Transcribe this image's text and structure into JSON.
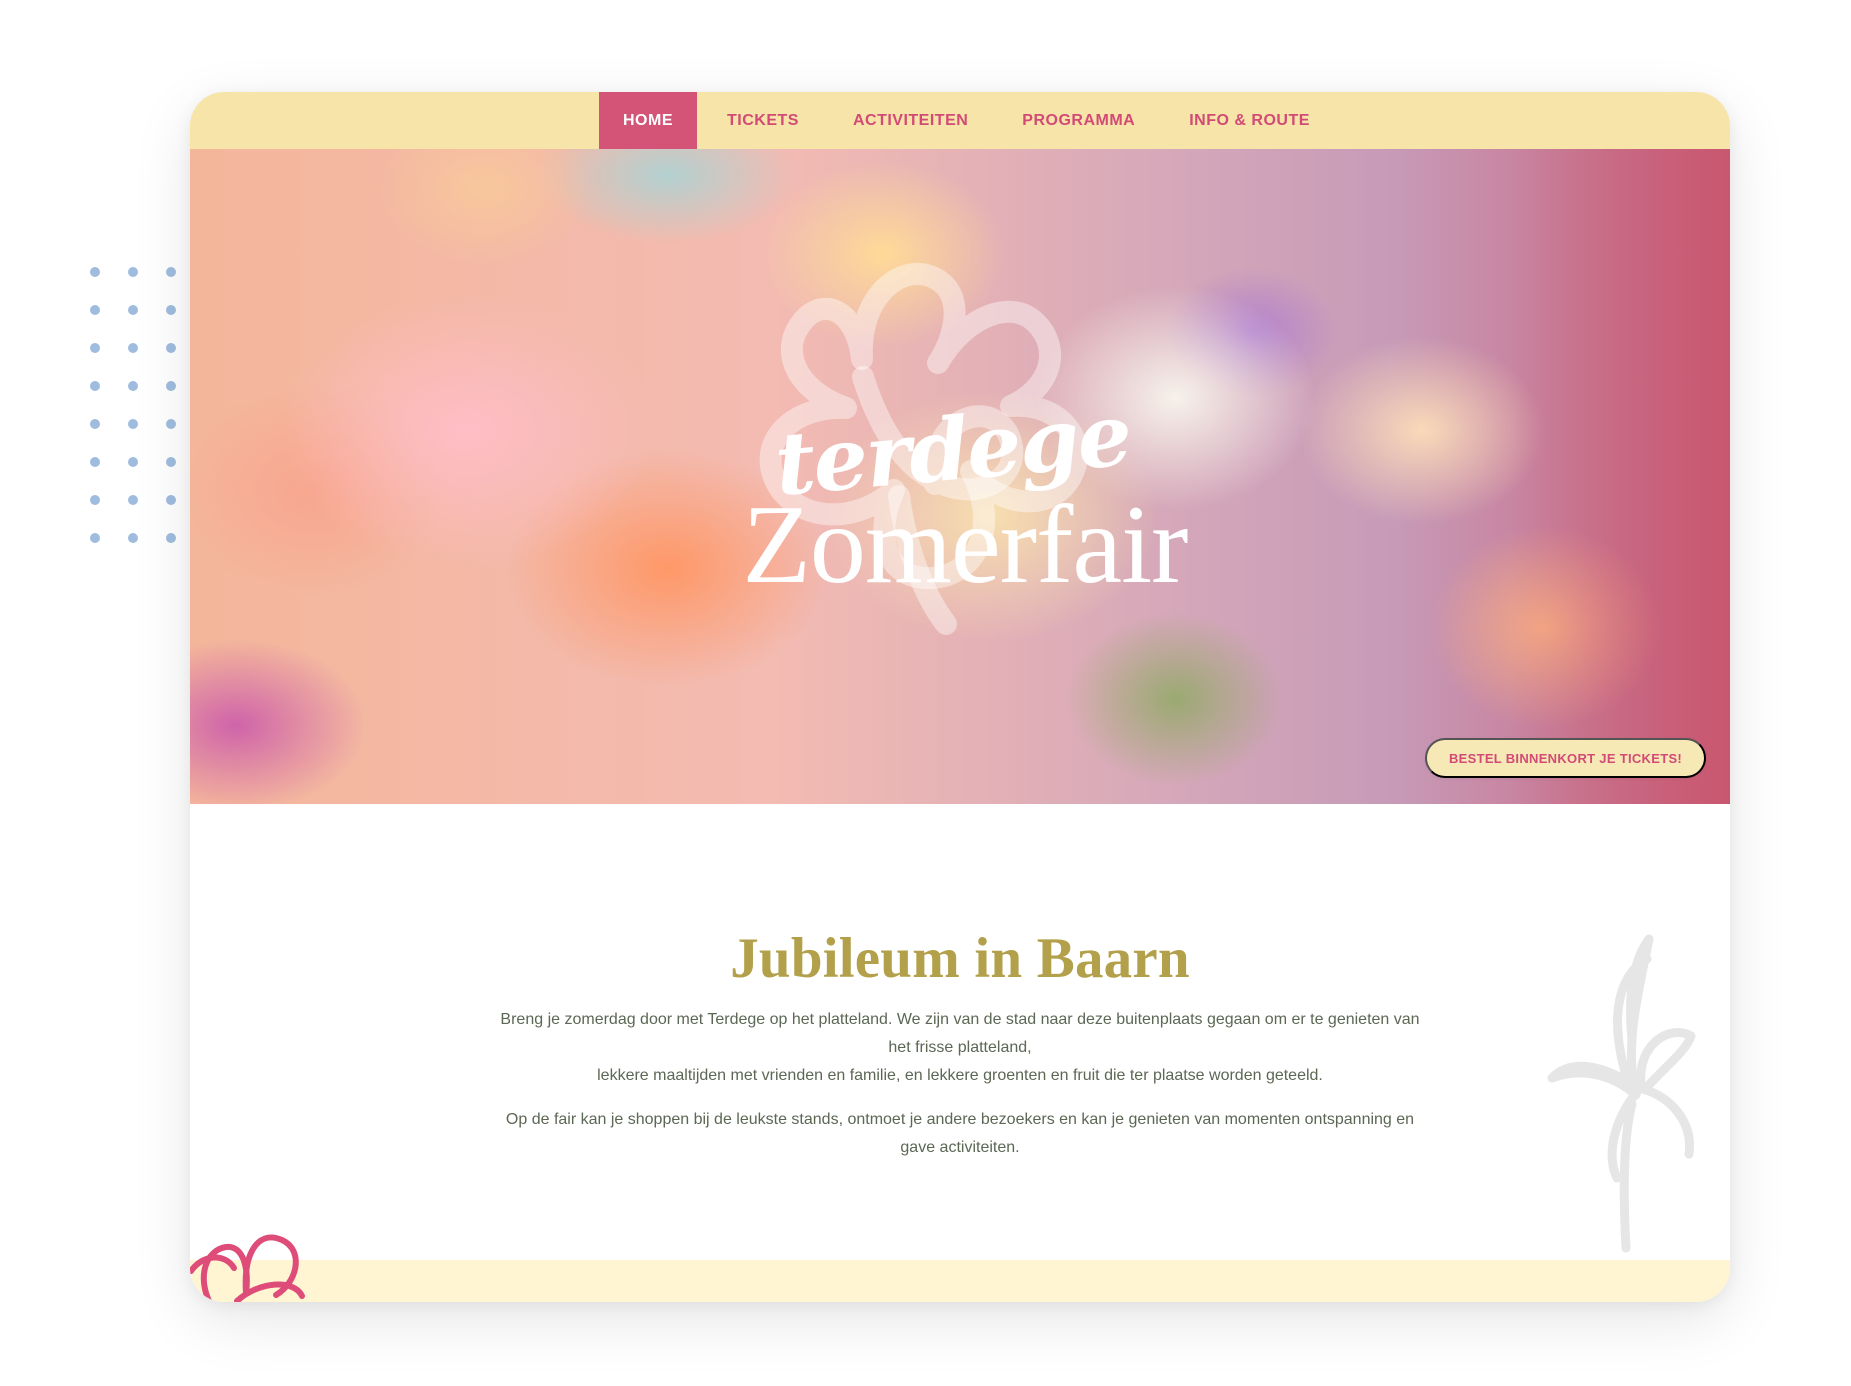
{
  "navigation": {
    "items": [
      {
        "label": "HOME",
        "active": true
      },
      {
        "label": "TICKETS",
        "active": false
      },
      {
        "label": "ACTIVITEITEN",
        "active": false
      },
      {
        "label": "PROGRAMMA",
        "active": false
      },
      {
        "label": "INFO & ROUTE",
        "active": false
      }
    ]
  },
  "hero": {
    "logo_script": "terdege",
    "logo_main": "Zomerfair",
    "ticket_button": "BESTEL BINNENKORT JE TICKETS!"
  },
  "content": {
    "title": "Jubileum in Baarn",
    "paragraph1_line1": "Breng je zomerdag door met Terdege op het platteland. We zijn van de stad naar deze buitenplaats gegaan om er te genieten van het frisse platteland,",
    "paragraph1_line2": "lekkere maaltijden met vrienden en familie, en lekkere groenten en fruit die ter plaatse worden geteeld.",
    "paragraph2": "Op de fair kan je shoppen bij de leukste stands, ontmoet je andere bezoekers en kan je genieten van momenten ontspanning en gave activiteiten."
  },
  "colors": {
    "nav_background": "#f6e4a8",
    "active_nav": "#d35477",
    "accent_pink": "#d24a75",
    "title_gold": "#b2a04a",
    "text": "#5c6754"
  },
  "icons": {
    "hero_logo": "flower-outline-logo",
    "decoration_gray": "gray-flower-illustration",
    "decoration_pink": "pink-flower-illustration"
  }
}
